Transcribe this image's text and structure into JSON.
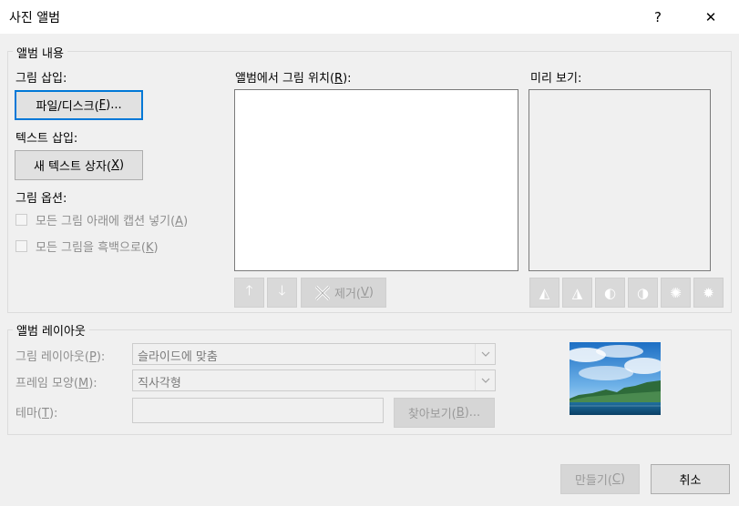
{
  "window": {
    "title": "사진 앨범",
    "help_label": "?",
    "close_label": "✕"
  },
  "content_group": {
    "legend": "앨범 내용",
    "insert_picture_label": "그림 삽입:",
    "file_disk_button": {
      "text": "파일/디스크(",
      "key": "F",
      "suffix": ")..."
    },
    "insert_text_label": "텍스트 삽입:",
    "new_textbox_button": {
      "text": "새 텍스트 상자(",
      "key": "X",
      "suffix": ")"
    },
    "picture_options_label": "그림 옵션:",
    "captions_checkbox": {
      "text": "모든 그림 아래에 캡션 넣기(",
      "key": "A",
      "suffix": ")"
    },
    "bw_checkbox": {
      "text": "모든 그림을 흑백으로(",
      "key": "K",
      "suffix": ")"
    },
    "pictures_in_album_label": {
      "text": "앨범에서 그림 위치(",
      "key": "R",
      "suffix": "):"
    },
    "remove_button": {
      "text": "제거(",
      "key": "V",
      "suffix": ")"
    },
    "preview_label": "미리 보기:"
  },
  "layout_group": {
    "legend": "앨범 레이아웃",
    "picture_layout_label": {
      "text": "그림 레이아웃(",
      "key": "P",
      "suffix": "):"
    },
    "picture_layout_value": "슬라이드에 맞춤",
    "frame_shape_label": {
      "text": "프레임 모양(",
      "key": "M",
      "suffix": "):"
    },
    "frame_shape_value": "직사각형",
    "theme_label": {
      "text": "테마(",
      "key": "T",
      "suffix": "):"
    },
    "browse_button": {
      "text": "찾아보기(",
      "key": "B",
      "suffix": ")..."
    }
  },
  "footer": {
    "create_button": {
      "text": "만들기(",
      "key": "C",
      "suffix": ")"
    },
    "cancel_button": "취소"
  },
  "colors": {
    "accent": "#0078d7",
    "dialog_bg": "#f0f0f0"
  }
}
